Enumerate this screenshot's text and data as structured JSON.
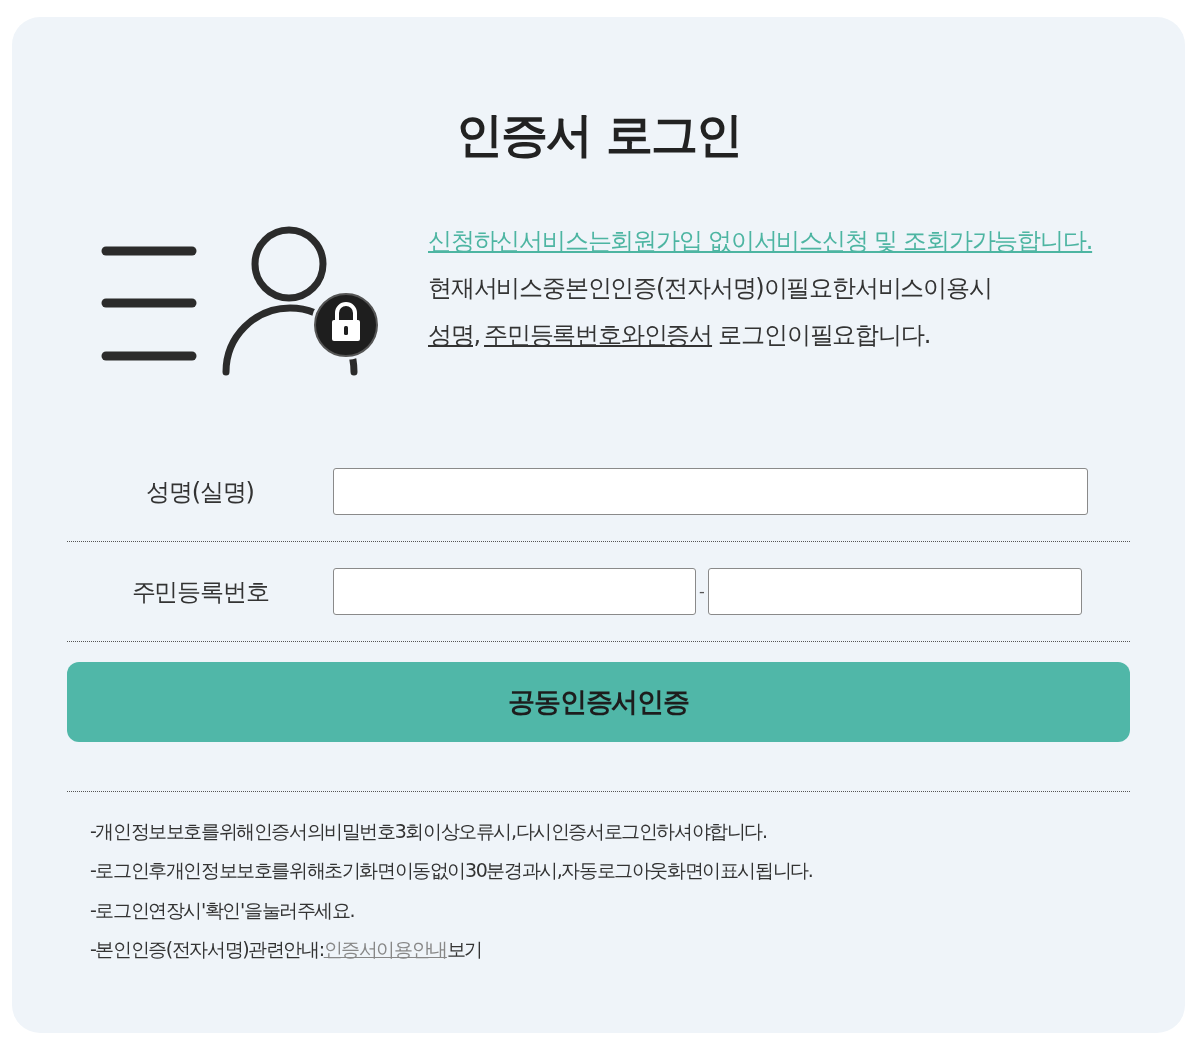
{
  "title": "인증서 로그인",
  "intro": {
    "link": "신청하신서비스는회원가입 없이서비스신청 및 조회가가능합니다.",
    "lines": [
      [
        {
          "text": "현재서비스중본인인증(전자서명)이필요한서비스이용시",
          "underlined": false
        }
      ],
      [
        {
          "text": "성명,",
          "underlined": true
        },
        {
          "text": "주민등록번호와인증서",
          "underlined": true
        },
        {
          "text": " 로그인이필요합니다.",
          "underlined": false
        }
      ]
    ]
  },
  "form": {
    "rows": [
      {
        "label": "성명(실명)",
        "kind": "single"
      },
      {
        "label": "주민등록번호",
        "kind": "split",
        "separator": "-"
      }
    ]
  },
  "submit_button": "공동인증서인증",
  "notes": [
    [
      {
        "kind": "text",
        "text": "-개인정보보호를위해인증서의비밀번호3회이상오류시,다시인증서로그인하셔야합니다."
      }
    ],
    [
      {
        "kind": "text",
        "text": "-로그인후개인정보보호를위해초기화면이동없이30분경과시,자동로그아웃화면이표시됩니다."
      }
    ],
    [
      {
        "kind": "text",
        "text": "-로그인연장시'확인'을눌러주세요."
      }
    ],
    [
      {
        "kind": "text",
        "text": "-본인인증(전자서명)관련안내:"
      },
      {
        "kind": "link",
        "text": "인증서이용안내"
      },
      {
        "kind": "text",
        "text": "보기"
      }
    ]
  ]
}
